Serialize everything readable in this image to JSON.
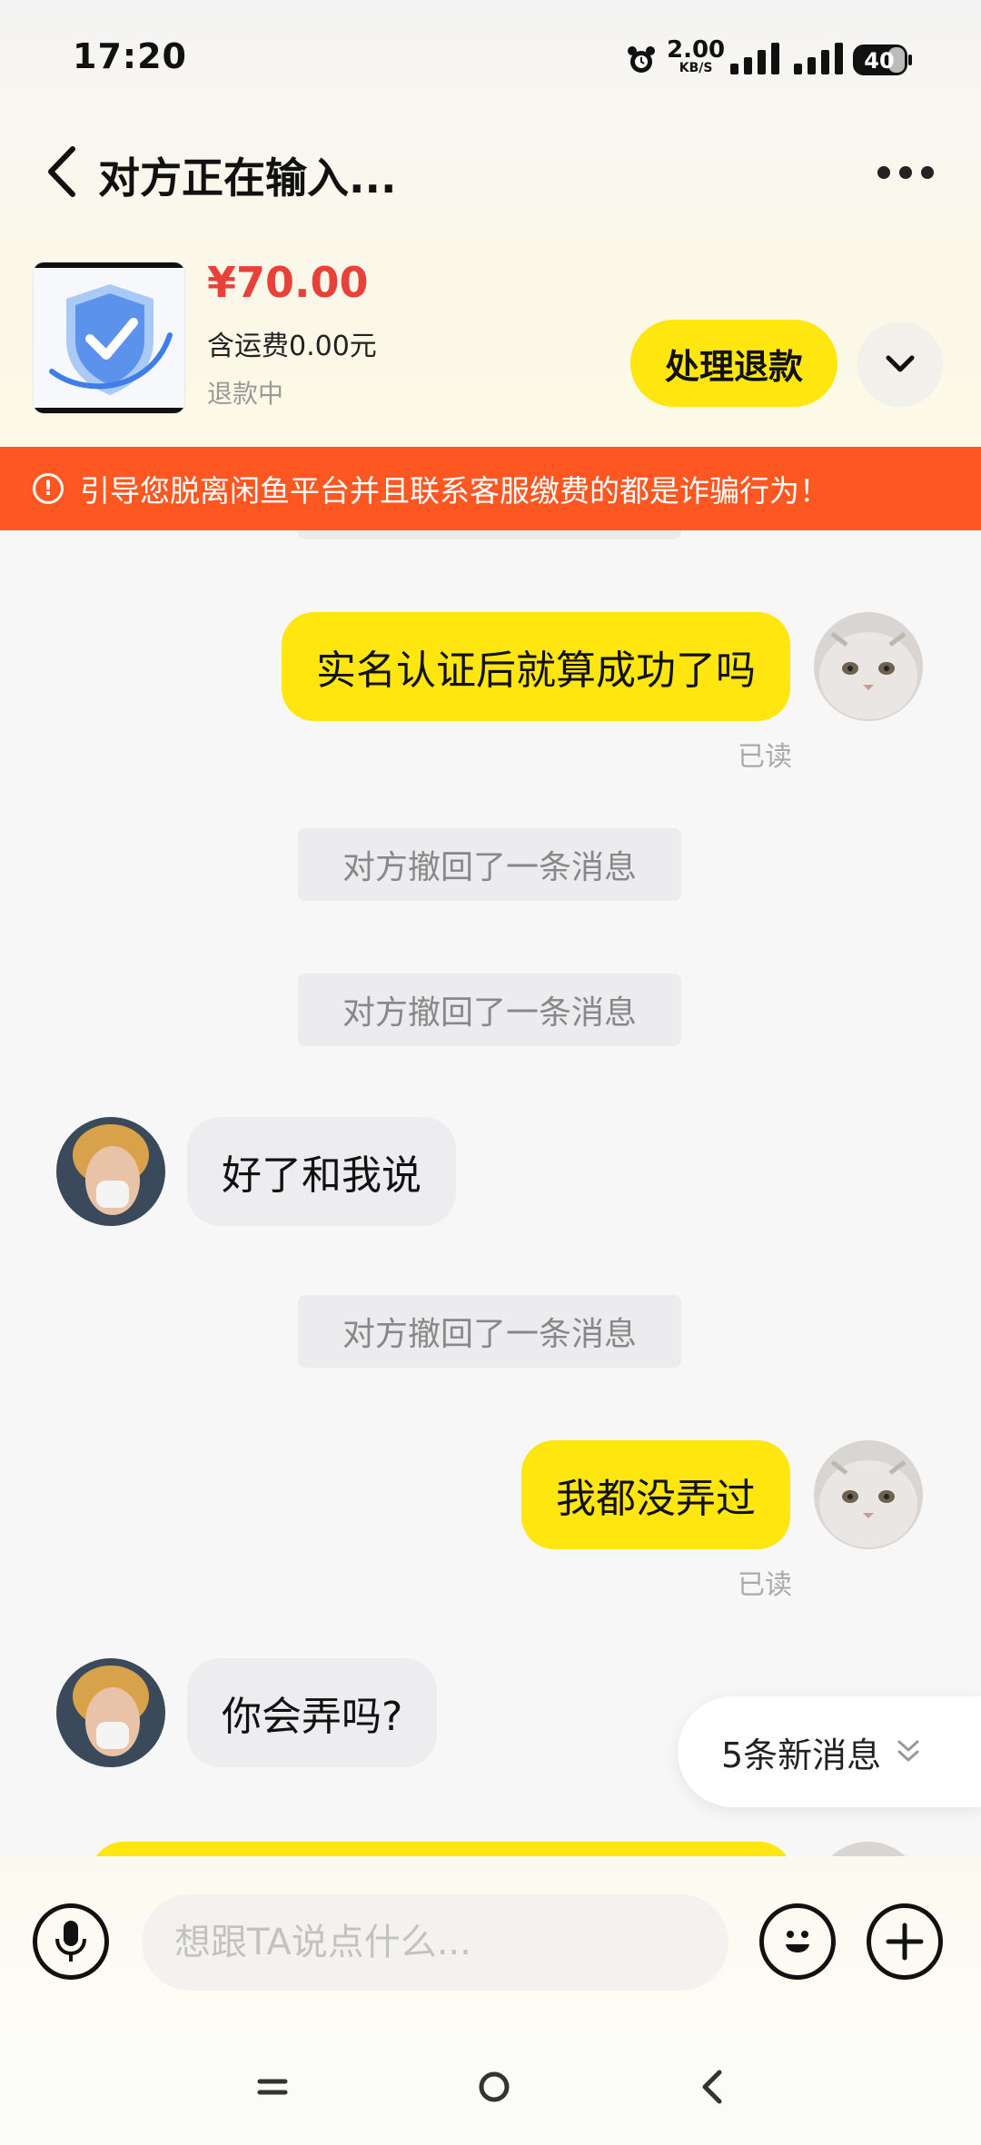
{
  "status_bar": {
    "time": "17:20",
    "net_speed_value": "2.00",
    "net_speed_unit": "KB/S",
    "battery": "40"
  },
  "header": {
    "title": "对方正在输入..."
  },
  "product": {
    "price": "¥70.00",
    "shipping": "含运费0.00元",
    "status": "退款中",
    "refund_button": "处理退款"
  },
  "warning": {
    "text": "引导您脱离闲鱼平台并且联系客服缴费的都是诈骗行为！"
  },
  "messages": {
    "m1": {
      "text": "实名认证后就算成功了吗",
      "read": "已读"
    },
    "recall_1": "对方撤回了一条消息",
    "recall_2": "对方撤回了一条消息",
    "m2": {
      "text": "好了和我说"
    },
    "recall_3": "对方撤回了一条消息",
    "m3": {
      "text": "我都没弄过",
      "read": "已读"
    },
    "m4": {
      "text": "你会弄吗?"
    }
  },
  "new_messages": {
    "label": "5条新消息"
  },
  "input": {
    "placeholder": "想跟TA说点什么..."
  },
  "colors": {
    "accent_yellow": "#ffe60f",
    "price_red": "#e8413a",
    "warning_orange": "#ff5722"
  }
}
